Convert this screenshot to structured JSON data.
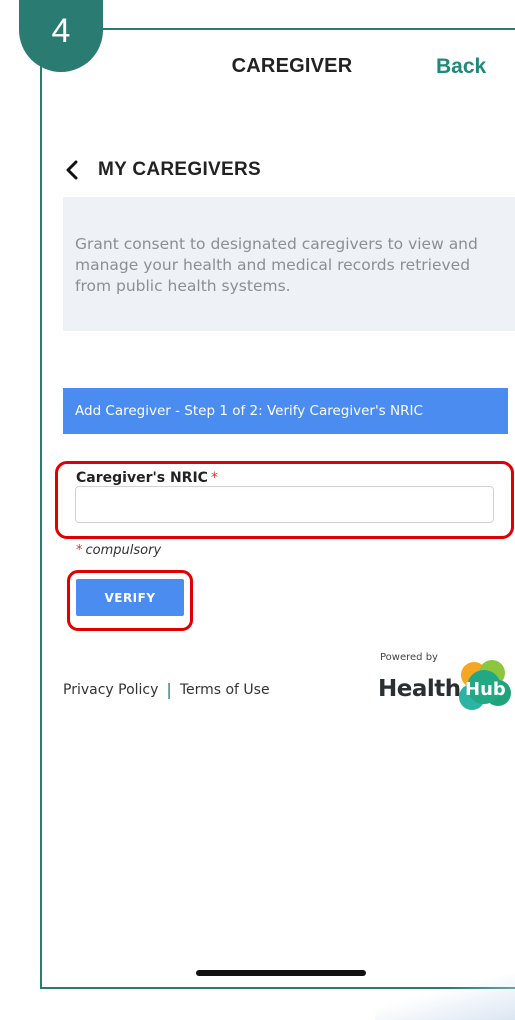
{
  "step_badge": "4",
  "header": {
    "title": "CAREGIVER",
    "back_label": "Back"
  },
  "nav": {
    "label": "MY CAREGIVERS"
  },
  "consent": {
    "text": "Grant consent to designated caregivers to view and manage your health and medical records retrieved from public health systems."
  },
  "step_bar": {
    "text": "Add Caregiver - Step 1 of 2: Verify Caregiver's NRIC"
  },
  "form": {
    "nric_label": "Caregiver's NRIC",
    "required_marker": "*",
    "nric_value": "",
    "compulsory_note": "compulsory",
    "verify_label": "VERIFY"
  },
  "footer": {
    "privacy_label": "Privacy Policy",
    "separator": "|",
    "terms_label": "Terms of Use",
    "powered_by": "Powered by",
    "logo_health": "Health",
    "logo_hub": "Hub"
  },
  "colors": {
    "teal": "#2a7b72",
    "primary_blue": "#4a8cf0",
    "highlight_red": "#e00000",
    "required_red": "#d9342b"
  }
}
